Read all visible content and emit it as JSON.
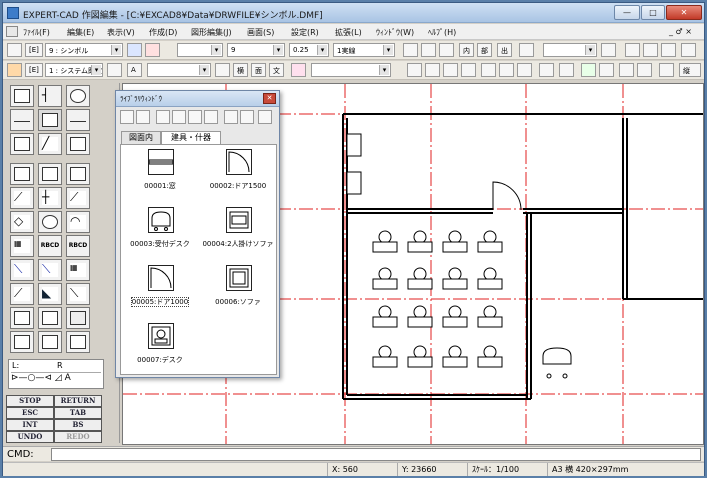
{
  "window": {
    "title": "EXPERT-CAD 作図編集 - [C:¥EXCAD8¥Data¥DRWFILE¥シンボル.DMF]",
    "min": "—",
    "max": "□",
    "close": "✕"
  },
  "menu": {
    "items": [
      "ﾌｧｲﾙ(F)",
      "編集(E)",
      "表示(V)",
      "作成(D)",
      "図形編集(J)",
      "画面(S)",
      "設定(R)",
      "拡張(L)",
      "ｳｨﾝﾄﾞｳ(W)",
      "ﾍﾙﾌﾟ(H)"
    ],
    "right": "_ ♂ ×"
  },
  "toolbar1": {
    "layer_flag": "[E]",
    "layer_value": "9 : シンボル",
    "color_value": "9",
    "width_value": "0.25",
    "linetype_value": "1実線"
  },
  "toolbar1_icons": [
    "内",
    "部",
    "出"
  ],
  "toolbar2": {
    "layer_flag": "[E]",
    "sys_value": "1 : システム既定",
    "btn_a": "A",
    "btn_kanji": [
      "横",
      "面",
      "文"
    ],
    "label_end": "縦"
  },
  "left_commands": [
    {
      "label": "STOP"
    },
    {
      "label": "RETURN"
    },
    {
      "label": "ESC"
    },
    {
      "label": "TAB"
    },
    {
      "label": "INT"
    },
    {
      "label": "BS"
    },
    {
      "label": "UNDO"
    },
    {
      "label": "REDO"
    }
  ],
  "left_io": {
    "l": "L:",
    "r": "R"
  },
  "left_tool_texts": [
    "RBCD",
    "RBCD"
  ],
  "palette": {
    "title": "ﾗｲﾌﾞﾗﾘｳｨﾝﾄﾞｳ",
    "close": "✕",
    "tabs": [
      "図面内",
      "建具・什器"
    ],
    "active_tab": 1,
    "symbols": [
      {
        "id": "00001",
        "label": "00001:窓"
      },
      {
        "id": "00002",
        "label": "00002:ドア1500"
      },
      {
        "id": "00003",
        "label": "00003:受付デスク"
      },
      {
        "id": "00004",
        "label": "00004:2人掛けソファ"
      },
      {
        "id": "00005",
        "label": "00005:ドア1000",
        "selected": true
      },
      {
        "id": "00006",
        "label": "00006:ソファ"
      },
      {
        "id": "00007",
        "label": "00007:デスク"
      }
    ]
  },
  "command": {
    "label": "CMD:",
    "value": ""
  },
  "status": {
    "x": "X: 560",
    "y": "Y: 23660",
    "scale": "ｽｹｰﾙ：1/100",
    "paper": "A3 横 420×297mm"
  },
  "colors": {
    "grid_red": "#e02020",
    "wall": "#c00000",
    "title_blue": "#a9c4e4"
  }
}
